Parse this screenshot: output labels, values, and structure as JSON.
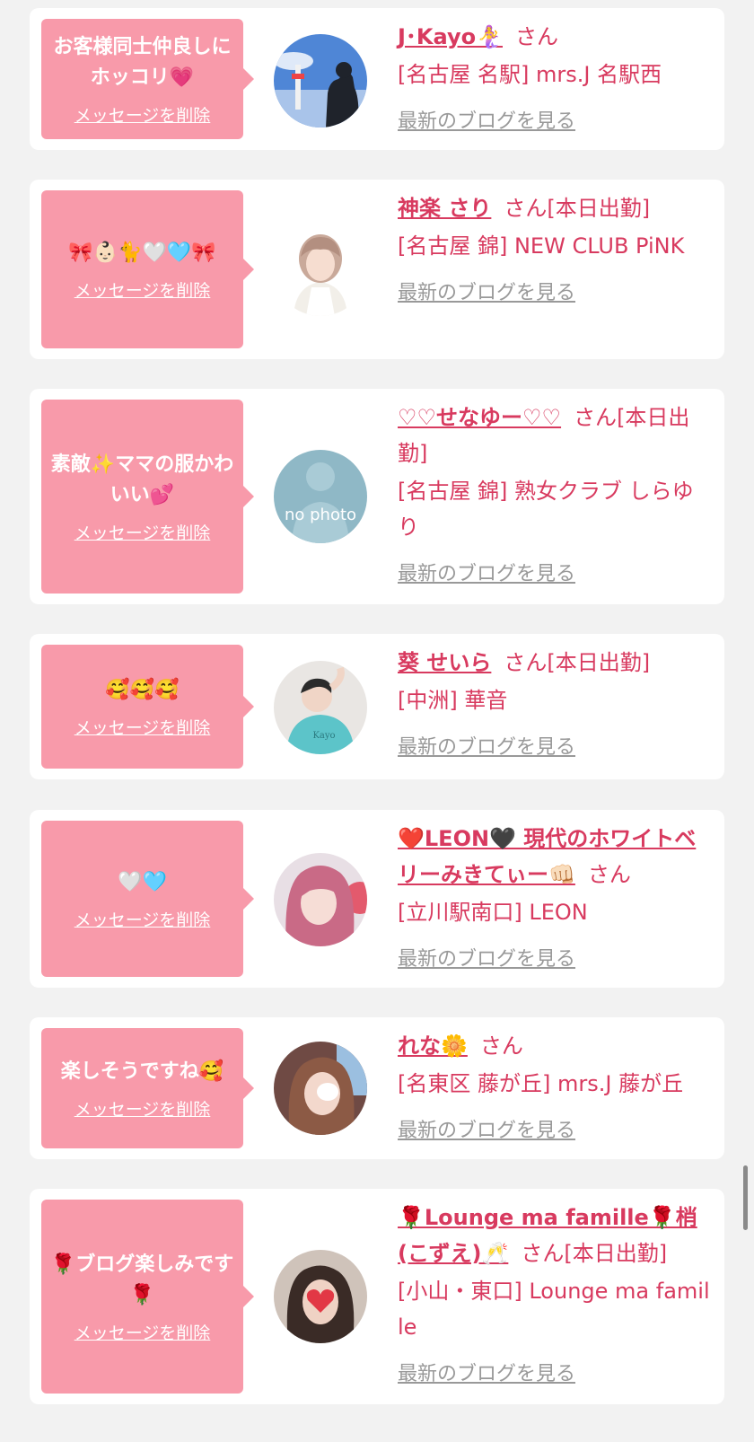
{
  "delete_label": "メッセージを削除",
  "blog_label": "最新のブログを見る",
  "san_label": "さん",
  "messages": [
    {
      "message": "お客様同士仲良しにホッコリ💗",
      "name": "J･Kayo🧜‍♀️",
      "status": "",
      "shop": "[名古屋 名駅] mrs.J 名駅西",
      "avatar_icon": "kyoto-tower-photo-avatar"
    },
    {
      "message": "🎀👶🏻🐈🤍🩵🎀",
      "name": "神楽 さり",
      "status": "[本日出勤]",
      "shop": "[名古屋 錦] NEW CLUB PiNK",
      "avatar_icon": "woman-portrait-avatar"
    },
    {
      "message": "素敵✨ママの服かわいい💕",
      "name": "♡♡せなゆー♡♡",
      "status": "[本日出勤]",
      "shop": "[名古屋 錦] 熟女クラブ しらゆり",
      "avatar_icon": "no-photo-avatar",
      "avatar_text": "no photo"
    },
    {
      "message": "🥰🥰🥰",
      "name": "葵 せいら",
      "status": "[本日出勤]",
      "shop": "[中洲] 華音",
      "avatar_icon": "woman-teal-shirt-avatar"
    },
    {
      "message": "🤍🩵",
      "name": "❤️LEON🖤 現代のホワイトベリーみきてぃー👊🏻",
      "status": "",
      "shop": "[立川駅南口] LEON",
      "avatar_icon": "pink-hair-woman-avatar"
    },
    {
      "message": "楽しそうですね🥰",
      "name": "れな🌼",
      "status": "",
      "shop": "[名東区 藤が丘] mrs.J 藤が丘",
      "avatar_icon": "woman-hidden-face-avatar"
    },
    {
      "message": "🌹ブログ楽しみです🌹",
      "name": "🌹Lounge ma famille🌹梢(こずえ)🥂",
      "status": "[本日出勤]",
      "shop": "[小山・東口] Lounge ma famille",
      "avatar_icon": "woman-heart-face-avatar"
    }
  ]
}
